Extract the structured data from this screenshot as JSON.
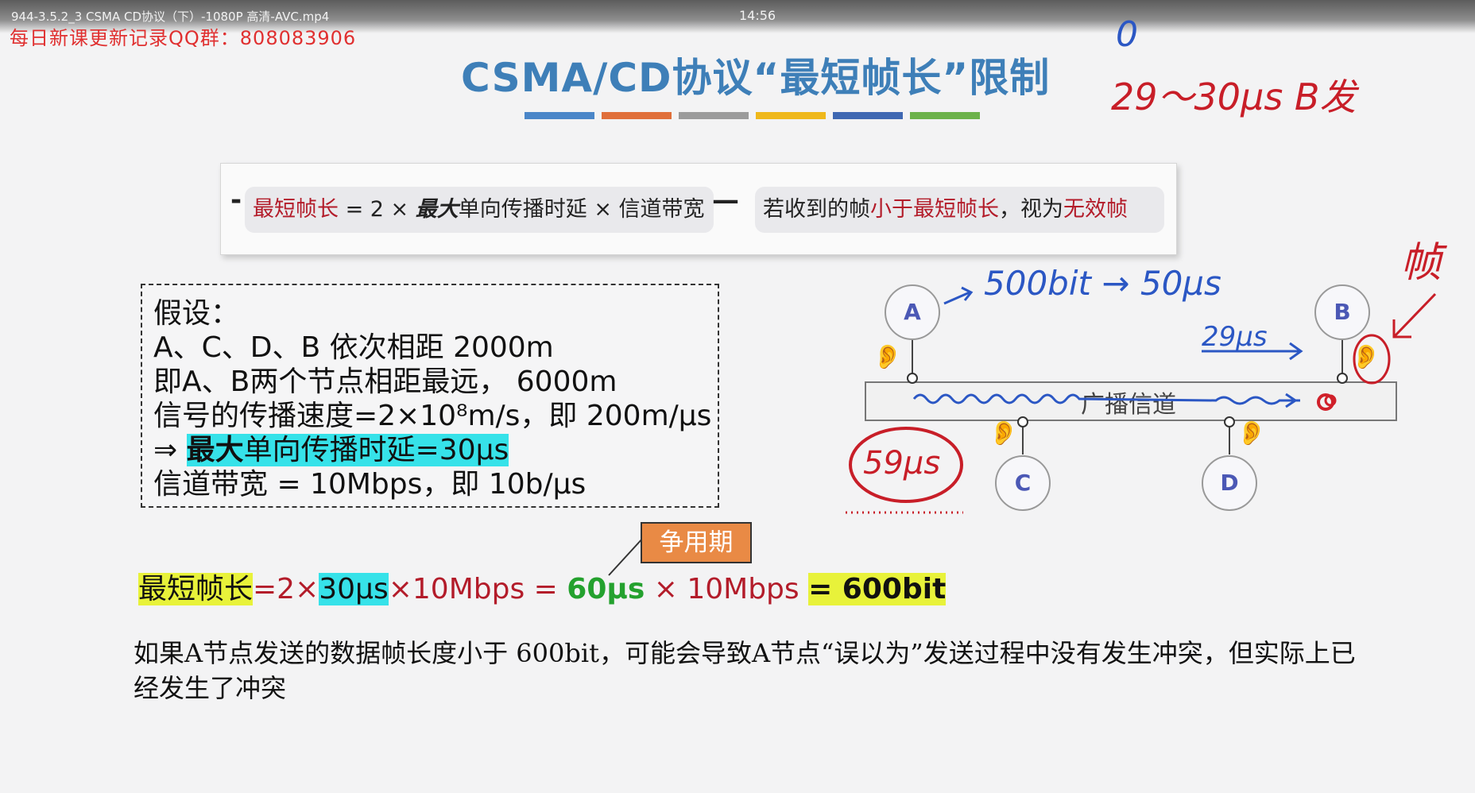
{
  "video": {
    "filename": "944-3.5.2_3 CSMA CD协议（下）-1080P 高清-AVC.mp4",
    "time": "14:56",
    "watermark": "每日新课更新记录QQ群：808083906"
  },
  "slide": {
    "title": "CSMA/CD协议“最短帧长”限制",
    "color_bars": [
      "#4a86c8",
      "#e06f3a",
      "#9b9b9b",
      "#efb81b",
      "#3f68b2",
      "#6cb24a"
    ],
    "formula_panel": {
      "bullet": "-",
      "formula": {
        "term1": "最短帧长",
        "op1": " = 2 × ",
        "term2": "最大",
        "term3": "单向传播时延 × 信道带宽"
      },
      "connector": "—",
      "rule": {
        "part1": "若收到的帧",
        "part2": "小于最短帧长",
        "part3": "，视为",
        "part4": "无效帧"
      }
    },
    "assumptions": {
      "heading": "假设：",
      "line1": "A、C、D、B 依次相距 2000m",
      "line2": "即A、B两个节点相距最远，  6000m",
      "line3": "信号的传播速度=2×10⁸m/s，即 200m/μs",
      "line4_arrow": "⇒ ",
      "line4_bold": "最大",
      "line4_rest": "单向传播时延=30μs",
      "line5": "信道带宽 = 10Mbps，即 10b/μs"
    },
    "callout": "争用期",
    "equation": {
      "p1": "最短帧长",
      "p2": "=2×",
      "p3": "30μs",
      "p4": "×10Mbps = ",
      "p5": "60μs",
      "p6": " × 10Mbps  ",
      "p7": "= 600bit"
    },
    "paragraph": "如果A节点发送的数据帧长度小于 600bit，可能会导致A节点“误以为”发送过程中没有发生冲突，但实际上已经发生了冲突",
    "diagram": {
      "nodes": [
        "A",
        "B",
        "C",
        "D"
      ],
      "channel_label": "广播信道"
    },
    "handwriting": {
      "top_zero": "0",
      "top_range": "29～30μs B发",
      "rate": "500bit → 50μs",
      "b_arrow": "29μs",
      "frame_char": "帧",
      "circled": "59μs"
    }
  }
}
